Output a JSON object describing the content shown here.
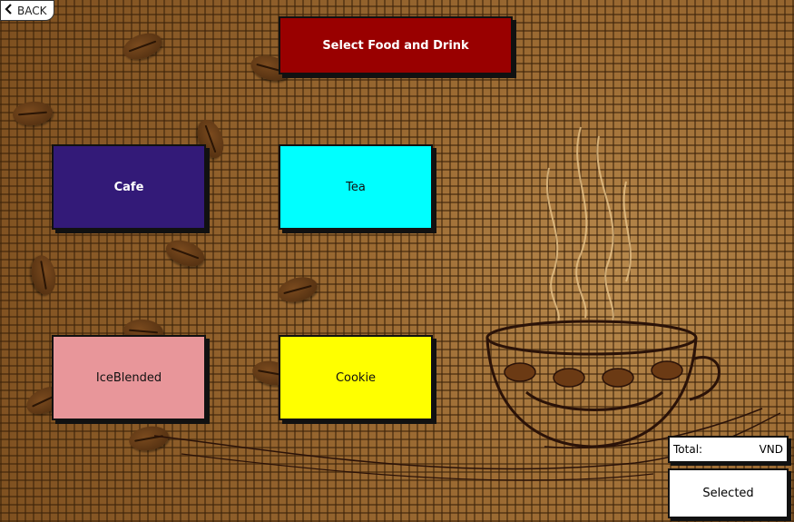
{
  "back_button": {
    "label": "BACK",
    "icon": "chevron-left-icon"
  },
  "header": {
    "title": "Select Food and Drink",
    "color": "#990000"
  },
  "categories": [
    {
      "label": "Cafe",
      "color": "#331a78",
      "text_color": "#ffffff"
    },
    {
      "label": "Tea",
      "color": "#00ffff",
      "text_color": "#111111"
    },
    {
      "label": "IceBlended",
      "color": "#e8969a",
      "text_color": "#111111"
    },
    {
      "label": "Cookie",
      "color": "#ffff00",
      "text_color": "#111111"
    }
  ],
  "summary": {
    "total_label": "Total:",
    "currency": "VND",
    "selected_label": "Selected"
  },
  "decoration": {
    "background": "coffee-beans-burlap",
    "illustration": "coffee-cup-steam"
  }
}
